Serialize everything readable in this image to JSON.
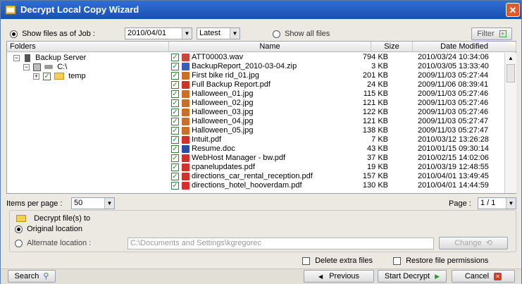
{
  "window": {
    "title": "Decrypt Local Copy Wizard"
  },
  "options": {
    "show_as_of_label": "Show files as of Job :",
    "job_date": "2010/04/01",
    "version": "Latest",
    "show_all_label": "Show all files",
    "filter_label": "Filter"
  },
  "columns": {
    "folders": "Folders",
    "name": "Name",
    "size": "Size",
    "date": "Date Modified"
  },
  "tree": [
    {
      "label": "Backup Server"
    },
    {
      "label": "C:\\"
    },
    {
      "label": "temp"
    }
  ],
  "files": [
    {
      "name": "ATT00003.wav",
      "size": "794 KB",
      "date": "2010/03/24 10:34:06",
      "icon": "audio-icon",
      "color": "#c8463a"
    },
    {
      "name": "BackupReport_2010-03-04.zip",
      "size": "3 KB",
      "date": "2010/03/05 13:33:40",
      "icon": "zip-icon",
      "color": "#3b5db8"
    },
    {
      "name": "First bike rid_01.jpg",
      "size": "201 KB",
      "date": "2009/11/03 05:27:44",
      "icon": "image-icon",
      "color": "#c8702a"
    },
    {
      "name": "Full Backup Report.pdf",
      "size": "24 KB",
      "date": "2009/11/06 08:39:41",
      "icon": "pdf-icon",
      "color": "#d0312d"
    },
    {
      "name": "Halloween_01.jpg",
      "size": "115 KB",
      "date": "2009/11/03 05:27:46",
      "icon": "image-icon",
      "color": "#c8702a"
    },
    {
      "name": "Halloween_02.jpg",
      "size": "121 KB",
      "date": "2009/11/03 05:27:46",
      "icon": "image-icon",
      "color": "#c8702a"
    },
    {
      "name": "Halloween_03.jpg",
      "size": "122 KB",
      "date": "2009/11/03 05:27:46",
      "icon": "image-icon",
      "color": "#c8702a"
    },
    {
      "name": "Halloween_04.jpg",
      "size": "121 KB",
      "date": "2009/11/03 05:27:47",
      "icon": "image-icon",
      "color": "#c8702a"
    },
    {
      "name": "Halloween_05.jpg",
      "size": "138 KB",
      "date": "2009/11/03 05:27:47",
      "icon": "image-icon",
      "color": "#c8702a"
    },
    {
      "name": "Intuit.pdf",
      "size": "7 KB",
      "date": "2010/03/12 13:26:28",
      "icon": "pdf-icon",
      "color": "#d0312d"
    },
    {
      "name": "Resume.doc",
      "size": "43 KB",
      "date": "2010/01/15 09:30:14",
      "icon": "word-icon",
      "color": "#2b4ea3"
    },
    {
      "name": "WebHost Manager - bw.pdf",
      "size": "37 KB",
      "date": "2010/02/15 14:02:06",
      "icon": "pdf-icon",
      "color": "#d0312d"
    },
    {
      "name": "cpanelupdates.pdf",
      "size": "19 KB",
      "date": "2010/03/19 12:48:55",
      "icon": "pdf-icon",
      "color": "#d0312d"
    },
    {
      "name": "directions_car_rental_reception.pdf",
      "size": "157 KB",
      "date": "2010/04/01 13:49:45",
      "icon": "pdf-icon",
      "color": "#d0312d"
    },
    {
      "name": "directions_hotel_hooverdam.pdf",
      "size": "130 KB",
      "date": "2010/04/01 14:44:59",
      "icon": "pdf-icon",
      "color": "#d0312d"
    }
  ],
  "paging": {
    "per_page_label": "Items per page :",
    "per_page": "50",
    "page_label": "Page :",
    "page": "1 / 1"
  },
  "decrypt": {
    "heading": "Decrypt file(s) to",
    "original": "Original location",
    "alternate": "Alternate location :",
    "path": "C:\\Documents and Settings\\kgregorec",
    "change": "Change"
  },
  "extras": {
    "delete_extra": "Delete extra files",
    "restore_perm": "Restore file permissions"
  },
  "buttons": {
    "search": "Search",
    "previous": "Previous",
    "start": "Start Decrypt",
    "cancel": "Cancel"
  }
}
